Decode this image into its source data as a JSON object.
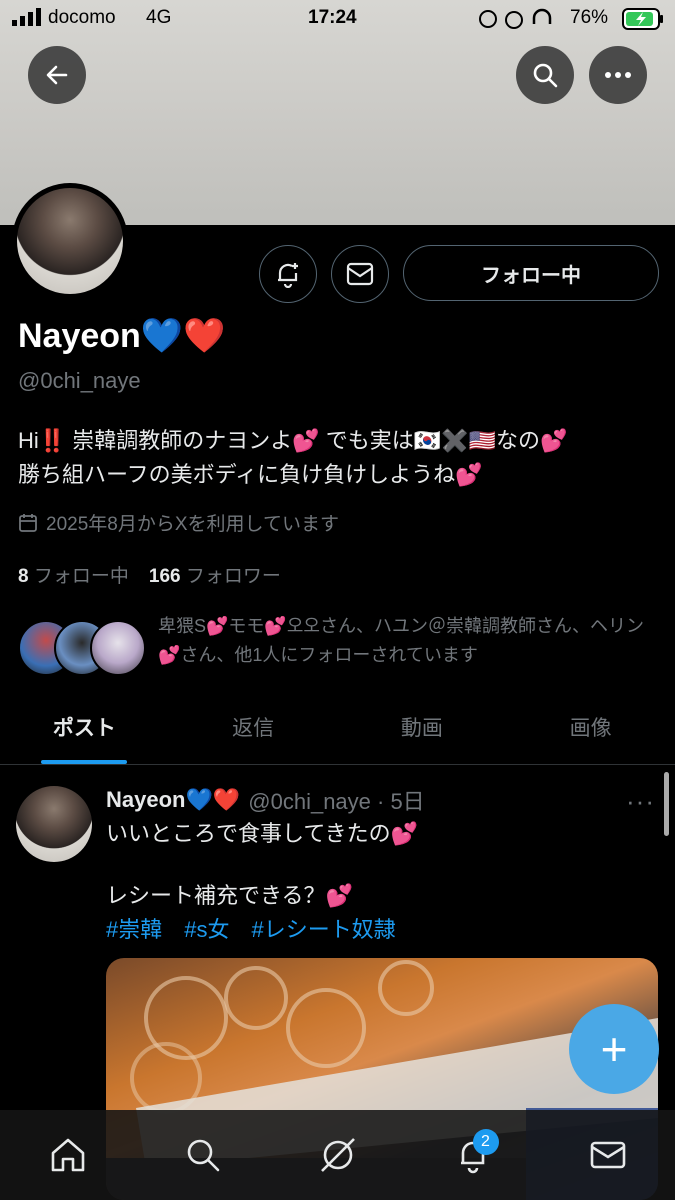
{
  "status_bar": {
    "carrier": "docomo",
    "network": "4G",
    "time": "17:24",
    "battery": "76%"
  },
  "profile": {
    "name": "Nayeon💙❤️",
    "handle": "@0chi_naye",
    "bio_line1": "Hi‼️ 崇韓調教師のナヨンよ💕 でも実は🇰🇷✖️🇺🇸なの💕",
    "bio_line2": "勝ち組ハーフの美ボディに負け負けしようね💕",
    "joined": "2025年8月からXを利用しています",
    "following_count": "8",
    "following_label": "フォロー中",
    "followers_count": "166",
    "followers_label": "フォロワー",
    "followed_by": "卑猥S💕モモ💕오오さん、ハユン＠崇韓調教師さん、ヘリン💕さん、他1人にフォローされています",
    "follow_button": "フォロー中"
  },
  "tabs": [
    {
      "label": "ポスト",
      "active": true
    },
    {
      "label": "返信",
      "active": false
    },
    {
      "label": "動画",
      "active": false
    },
    {
      "label": "画像",
      "active": false
    }
  ],
  "post": {
    "name": "Nayeon💙❤️",
    "handle_time": "@0chi_naye · 5日",
    "line1": "いいところで食事してきたの💕",
    "line2": "レシート補充できる？💕",
    "hashtags": [
      "#崇韓",
      "#s女",
      "#レシート奴隷"
    ]
  },
  "fab_label": "+",
  "nav": {
    "notification_badge": "2"
  },
  "icons": {
    "back": "back-arrow-icon",
    "search": "search-icon",
    "more": "more-icon",
    "notify": "bell-plus-icon",
    "message": "envelope-icon",
    "calendar": "calendar-icon"
  },
  "colors": {
    "accent": "#1d9bf0",
    "background": "#000000",
    "secondary_text": "#71767b"
  }
}
